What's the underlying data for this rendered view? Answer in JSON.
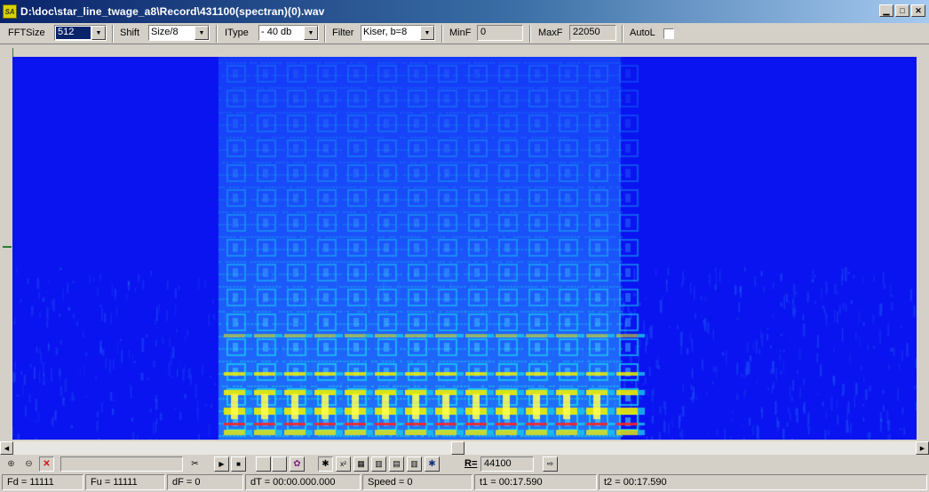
{
  "window": {
    "title": "D:\\doc\\star_line_twage_a8\\Record\\431100(spectran)(0).wav",
    "app_icon_text": "SA"
  },
  "toolbar": {
    "fft_size": {
      "label": "FFTSize",
      "value": "512"
    },
    "shift": {
      "label": "Shift",
      "value": "Size/8"
    },
    "itype": {
      "label": "IType",
      "value": "- 40 db"
    },
    "filter": {
      "label": "Filter",
      "value": "Kiser, b=8"
    },
    "min_f": {
      "label": "MinF",
      "value": "0"
    },
    "max_f": {
      "label": "MaxF",
      "value": "22050"
    },
    "auto_l": {
      "label": "AutoL",
      "checked": false
    }
  },
  "toolbar2": {
    "rate_label": "R=",
    "rate_value": "44100"
  },
  "status": {
    "fd": "Fd = 11111",
    "fu": "Fu = 11111",
    "df": "dF = 0",
    "dt": "dT = 00:00.000.000",
    "speed": "Speed = 0",
    "t1": "t1 = 00:17.590",
    "t2": "t2 = 00:17.590"
  },
  "colors": {
    "spectrum_background": "#0a14f0",
    "spectrum_low": "#1e5aff",
    "spectrum_mid": "#19c8e8",
    "spectrum_high": "#f0f000",
    "spectrum_peak": "#ff2020"
  }
}
